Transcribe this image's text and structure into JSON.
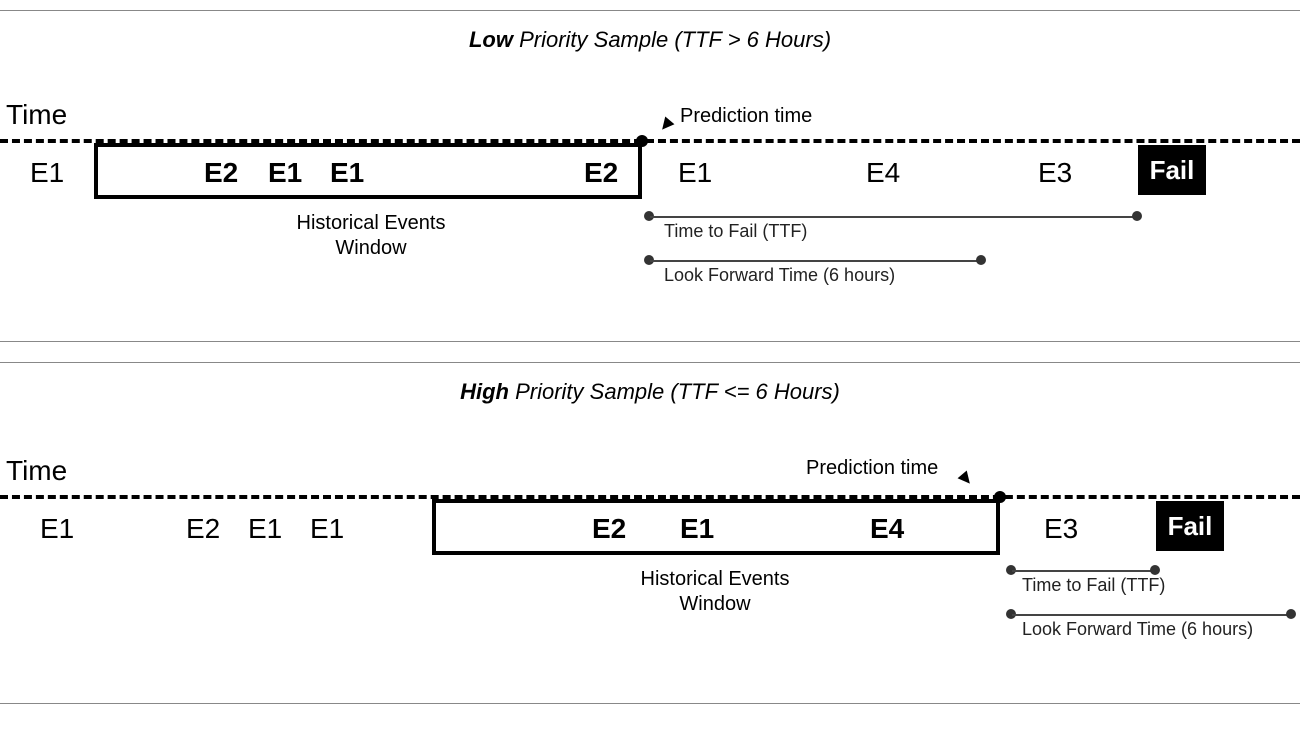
{
  "panelA": {
    "title_prefix": "Low",
    "title_rest": " Priority Sample (TTF > 6 Hours)",
    "time_label": "Time",
    "events_outside_left": [
      "E1"
    ],
    "events_in_box": [
      "E2",
      "E1",
      "E1",
      "E2"
    ],
    "events_after_box": [
      "E1",
      "E4",
      "E3"
    ],
    "hist_label_l1": "Historical Events",
    "hist_label_l2": "Window",
    "pred_label": "Prediction time",
    "ttf_label": "Time to Fail (TTF)",
    "lft_label": "Look Forward Time (6 hours)",
    "fail_label": "Fail"
  },
  "panelB": {
    "title_prefix": "High",
    "title_rest": " Priority Sample (TTF <= 6 Hours)",
    "time_label": "Time",
    "events_outside_left": [
      "E1",
      "E2",
      "E1",
      "E1"
    ],
    "events_in_box": [
      "E2",
      "E1",
      "E4"
    ],
    "events_after_box": [
      "E3"
    ],
    "hist_label_l1": "Historical Events",
    "hist_label_l2": "Window",
    "pred_label": "Prediction time",
    "ttf_label": "Time to Fail (TTF)",
    "lft_label": "Look Forward Time (6 hours)",
    "fail_label": "Fail"
  }
}
